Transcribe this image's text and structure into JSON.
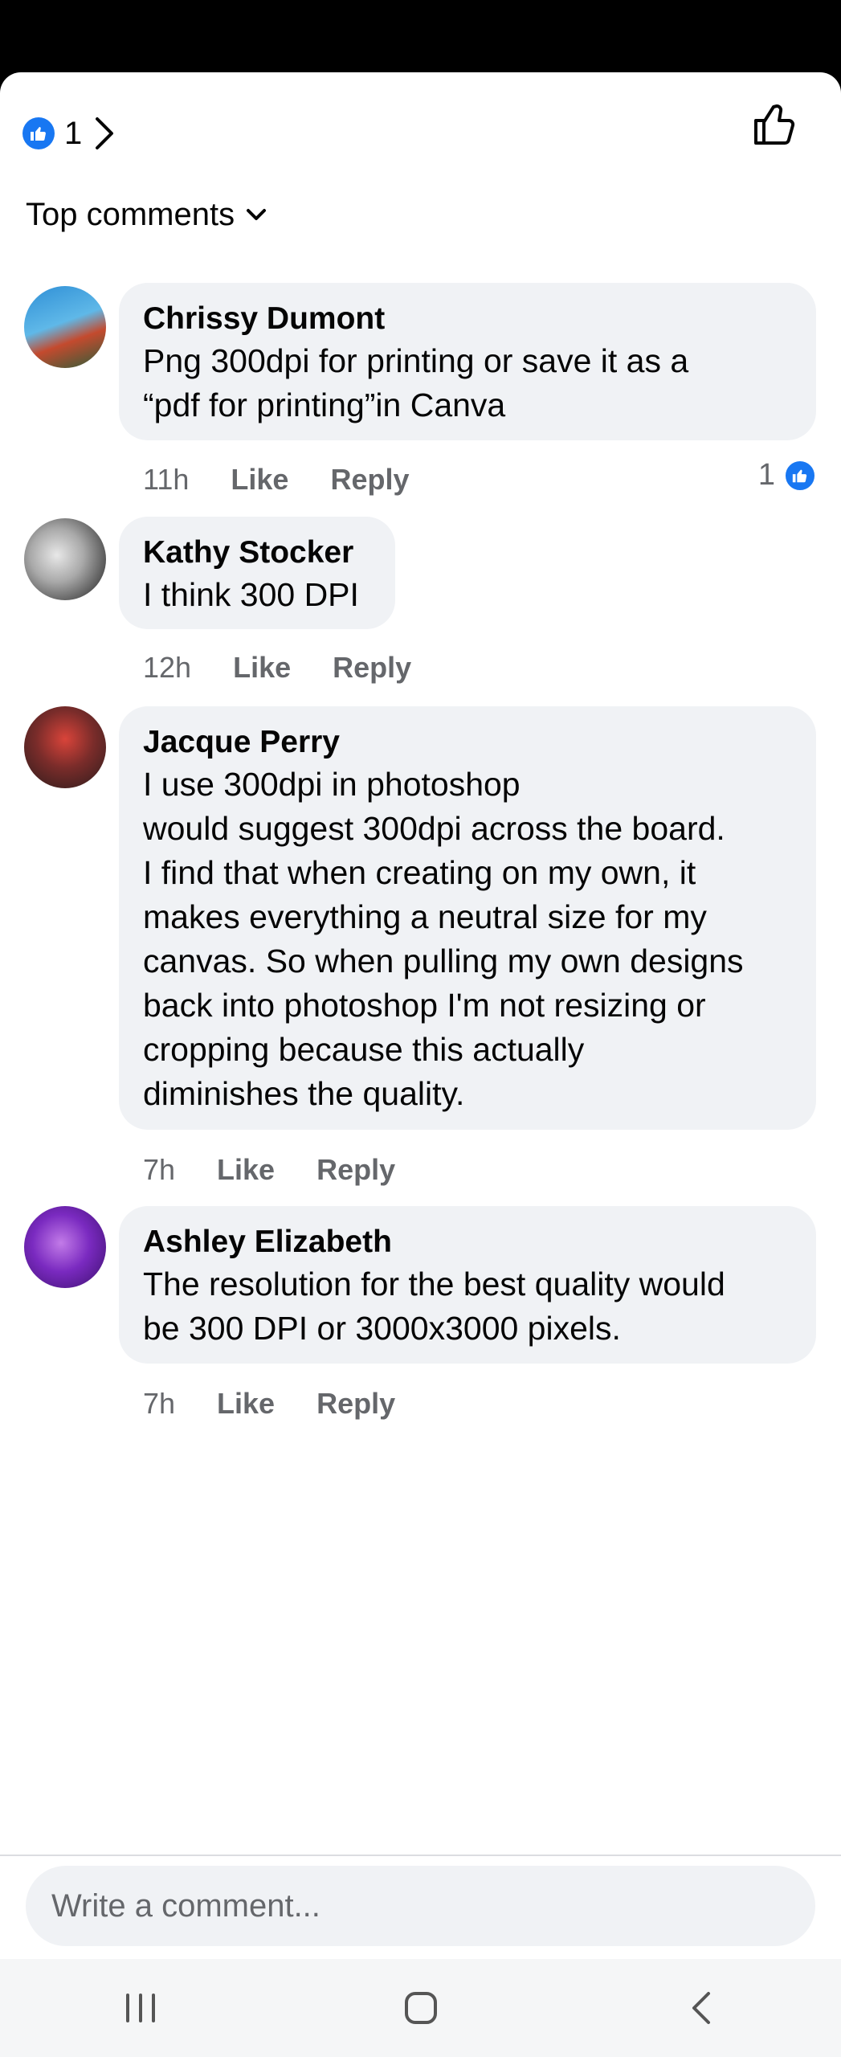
{
  "reactions": {
    "count": "1"
  },
  "section_title": "Top comments",
  "comments": [
    {
      "author": "Chrissy Dumont",
      "text": "Png 300dpi for printing or save it as a\n“pdf for printing”in Canva",
      "time": "11h",
      "like": "Like",
      "reply": "Reply",
      "reaction_count": "1"
    },
    {
      "author": "Kathy Stocker",
      "text": "I think 300 DPI",
      "time": "12h",
      "like": "Like",
      "reply": "Reply"
    },
    {
      "author": "Jacque Perry",
      "text": "I use 300dpi in photoshop\nwould suggest 300dpi across the board.\nI find that when creating on my own, it\nmakes everything a neutral size for my\ncanvas. So when pulling my own designs\nback into photoshop I'm not resizing or\ncropping because this actually\ndiminishes the quality.",
      "time": "7h",
      "like": "Like",
      "reply": "Reply"
    },
    {
      "author": "Ashley Elizabeth",
      "text": "The resolution for the best quality would\nbe 300 DPI or 3000x3000 pixels.",
      "time": "7h",
      "like": "Like",
      "reply": "Reply"
    }
  ],
  "composer": {
    "placeholder": "Write a comment..."
  },
  "colors": {
    "accent": "#1877f2",
    "bubble": "#f0f2f5",
    "secondary_text": "#65676b"
  },
  "icons": [
    "like-badge-icon",
    "chevron-right-icon",
    "thumbs-up-icon",
    "chevron-down-icon",
    "recents-icon",
    "home-icon",
    "back-icon"
  ]
}
